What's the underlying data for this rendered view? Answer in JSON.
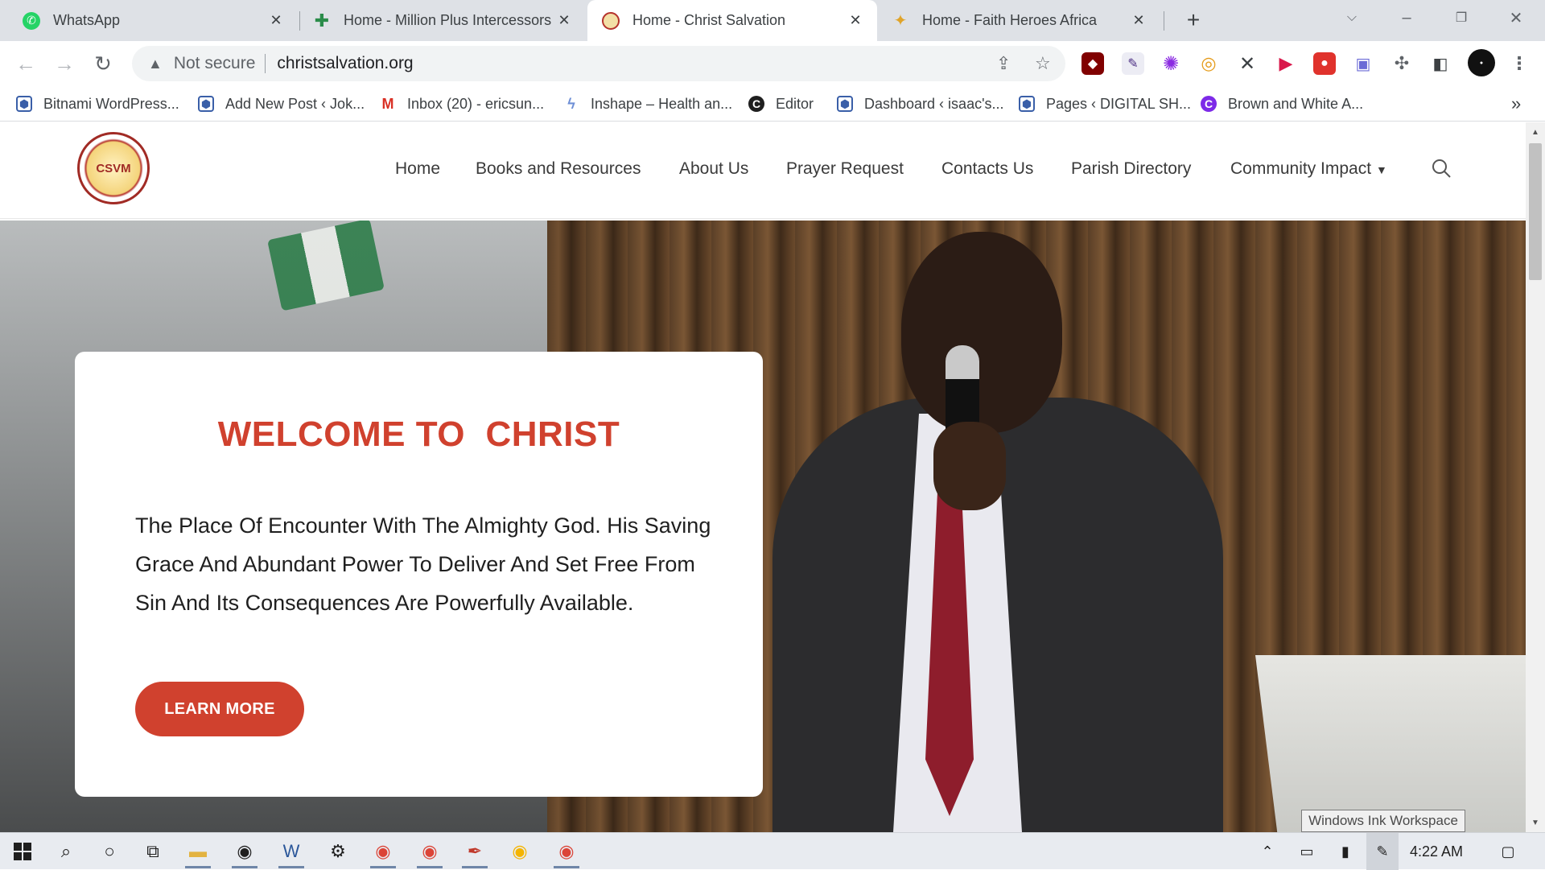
{
  "browser": {
    "tabs": [
      {
        "title": "WhatsApp",
        "icon": "whatsapp-icon",
        "color": "#25d366"
      },
      {
        "title": "Home - Million Plus Intercessors",
        "icon": "cross-icon",
        "color": "#2a8c4a"
      },
      {
        "title": "Home - Christ Salvation",
        "icon": "church-logo-icon",
        "color": "#c8a451"
      },
      {
        "title": "Home - Faith Heroes Africa",
        "icon": "faith-heroes-icon",
        "color": "#e0a42a"
      }
    ],
    "url_warning": "Not secure",
    "url": "christsalvation.org",
    "bookmarks": [
      {
        "label": "Bitnami WordPress...",
        "icon": "wordpress-hex-icon"
      },
      {
        "label": "Add New Post ‹ Jok...",
        "icon": "wordpress-hex-icon"
      },
      {
        "label": "Inbox (20) - ericsun...",
        "icon": "gmail-icon"
      },
      {
        "label": "Inshape – Health an...",
        "icon": "swirl-icon"
      },
      {
        "label": "Editor",
        "icon": "editor-c-icon"
      },
      {
        "label": "Dashboard ‹ isaac's...",
        "icon": "wordpress-hex-icon"
      },
      {
        "label": "Pages ‹ DIGITAL SH...",
        "icon": "wordpress-hex-icon"
      },
      {
        "label": "Brown and White A...",
        "icon": "canva-icon"
      }
    ],
    "bookmarks_overflow": "»"
  },
  "site": {
    "logo_text": "CSVM",
    "nav": [
      "Home",
      "Books and Resources",
      "About Us",
      "Prayer Request",
      "Contacts Us",
      "Parish Directory",
      "Community Impact"
    ],
    "hero": {
      "title": "WELCOME TO  CHRIST",
      "text": "The Place Of Encounter With The Almighty God. His Saving Grace And Abundant Power To Deliver And Set Free From Sin And Its Consequences Are Powerfully Available.",
      "button": "LEARN MORE"
    },
    "colors": {
      "accent": "#d0412e",
      "text": "#1f1f1f"
    }
  },
  "tooltip": "Windows Ink Workspace",
  "taskbar": {
    "clock": "4:22 AM"
  }
}
